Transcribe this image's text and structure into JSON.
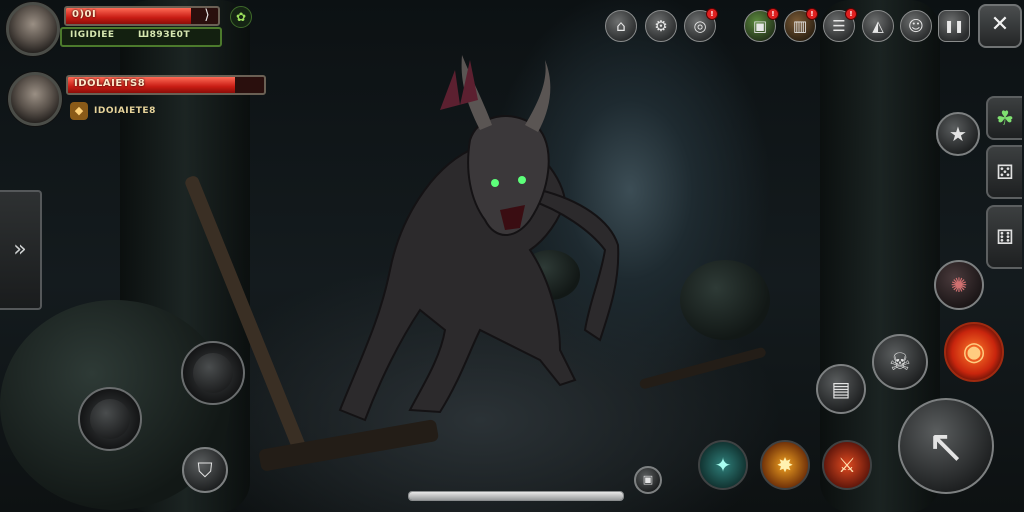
{
  "player": {
    "hp_text": "0)0I",
    "hp_fill": 0.82,
    "sub_text": "IIGIDIEE",
    "sub_value": "Ш89ЗЕ0Т",
    "badge_icon": "paw-icon"
  },
  "target": {
    "hp_text": "IDOLAIETS8",
    "hp_fill": 0.85,
    "sub_text": "IDOIAIETE8",
    "badge_icon": "shield-icon"
  },
  "top_icons": [
    {
      "name": "home-icon",
      "glyph": "⌂",
      "alert": false
    },
    {
      "name": "settings-icon",
      "glyph": "⚙",
      "alert": false
    },
    {
      "name": "compass-icon",
      "glyph": "◎",
      "alert": true
    },
    {
      "name": "gift-icon",
      "glyph": "▣",
      "alert": true
    },
    {
      "name": "chest-icon",
      "glyph": "▥",
      "alert": true
    },
    {
      "name": "quest-icon",
      "glyph": "☰",
      "alert": true
    },
    {
      "name": "helmet-icon",
      "glyph": "◭",
      "alert": false
    },
    {
      "name": "character-icon",
      "glyph": "☺",
      "alert": false
    },
    {
      "name": "pause-icon",
      "glyph": "❚❚",
      "alert": false
    }
  ],
  "close_glyph": "✕",
  "alert_mark": "!",
  "right_tabs": [
    "☘",
    "⚄",
    "⚅"
  ],
  "skills": {
    "star_glyph": "★",
    "summon_glyph": "✺",
    "map_glyph": "▤",
    "roar_glyph": "☠",
    "fire_glyph": "◉",
    "attack_glyph": "↖",
    "slot1_glyph": "✦",
    "slot2_glyph": "✸",
    "slot3_glyph": "⚔"
  },
  "left_tab_glyph": "»",
  "shield_glyph": "⛉",
  "lock_glyph": "🔒",
  "xp_fill": 1.0,
  "colors": {
    "hp_red": "#c81c14",
    "sub_green": "#4c7a2c",
    "fire_orange": "#e0401a"
  }
}
